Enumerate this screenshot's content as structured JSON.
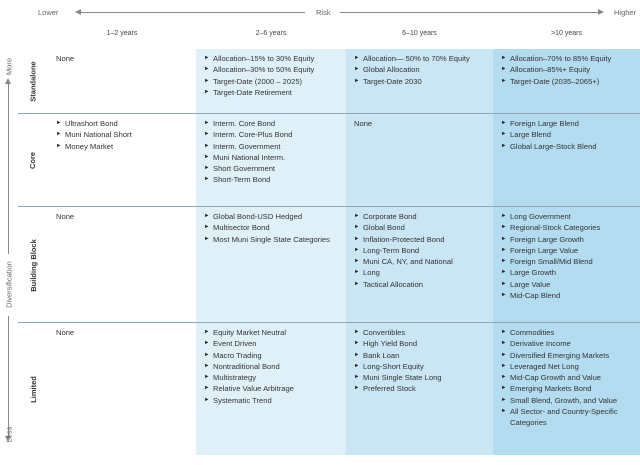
{
  "axes": {
    "risk_label": "Risk",
    "risk_low": "Lower",
    "risk_high": "Higher",
    "diversification_label": "Diversification",
    "div_high": "More",
    "div_low": "Less"
  },
  "columns": [
    "1–2 years",
    "2–6 years",
    "6–10 years",
    ">10 years"
  ],
  "rows": [
    {
      "label": "Standalone",
      "cells": [
        {
          "none": "None",
          "items": []
        },
        {
          "none": "",
          "items": [
            "Allocation–15% to 30% Equity",
            "Allocation–30% to 50% Equity",
            "Target-Date (2000 – 2025)",
            "Target-Date Retirement"
          ]
        },
        {
          "none": "",
          "items": [
            "Allocation— 50% to 70% Equity",
            "Global Allocation",
            "Target-Date 2030"
          ]
        },
        {
          "none": "",
          "items": [
            "Allocation–70% to 85% Equity",
            "Allocation–85%+ Equity",
            "Target-Date (2035–2065+)"
          ]
        }
      ]
    },
    {
      "label": "Core",
      "cells": [
        {
          "none": "",
          "items": [
            "Ultrashort Bond",
            "Muni National Short",
            "Money Market"
          ]
        },
        {
          "none": "",
          "items": [
            "Interm. Core Bond",
            "Interm. Core-Plus Bond",
            "Interm. Government",
            "Muni National Interm.",
            "Short Government",
            "Short-Term Bond"
          ]
        },
        {
          "none": "None",
          "items": []
        },
        {
          "none": "",
          "items": [
            "Foreign Large Blend",
            "Large Blend",
            "Global Large-Stock Blend"
          ]
        }
      ]
    },
    {
      "label": "Building Block",
      "cells": [
        {
          "none": "None",
          "items": []
        },
        {
          "none": "",
          "items": [
            "Global Bond-USD Hedged",
            "Multisector Bond",
            "Most Muni Single State Categories"
          ]
        },
        {
          "none": "",
          "items": [
            "Corporate Bond",
            "Global Bond",
            "Inflation-Protected Bond",
            "Long-Term Bond",
            "Muni CA, NY, and National",
            "Long",
            "Tactical Allocation"
          ]
        },
        {
          "none": "",
          "items": [
            "Long Government",
            "Regional-Stock Categories",
            "Foreign Large Growth",
            "Foreign Large Value",
            "Foreign Small/Mid Blend",
            "Large Growth",
            "Large Value",
            "Mid-Cap Blend"
          ]
        }
      ]
    },
    {
      "label": "Limited",
      "cells": [
        {
          "none": "None",
          "items": []
        },
        {
          "none": "",
          "items": [
            "Equity Market Neutral",
            "Event Driven",
            "Macro Trading",
            "Nontraditional Bond",
            "Multistrategy",
            "Relative Value Arbitrage",
            "Systematic Trend"
          ]
        },
        {
          "none": "",
          "items": [
            "Convertibles",
            "High Yield Bond",
            "Bank Loan",
            "Long-Short Equity",
            "Muni Single State Long",
            "Preferred Stock"
          ]
        },
        {
          "none": "",
          "items": [
            "Commodities",
            "Derivative Income",
            "Diversified Emerging Markets",
            "Leveraged Net Long",
            "Mid-Cap Growth and Value",
            "Emerging Markets Bond",
            "Small Blend, Growth, and Value",
            "All Sector- and Country-Specific Categories"
          ]
        }
      ]
    }
  ],
  "colors": {
    "col1": "#ffffff",
    "col2": "#e0f0f9",
    "col3": "#cae6f4",
    "col4": "#b4dcf0",
    "row_line": "#8fa7b5"
  }
}
